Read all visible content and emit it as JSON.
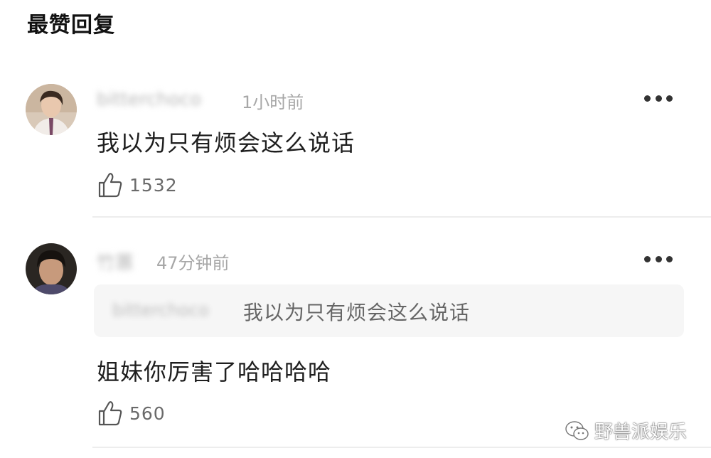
{
  "header": {
    "title": "最赞回复"
  },
  "comments": [
    {
      "username": "bitterchoco",
      "timestamp": "1小时前",
      "text": "我以为只有烦会这么说话",
      "likes": "1532"
    },
    {
      "username": "竹蕙",
      "timestamp": "47分钟前",
      "quote": {
        "username": "bitterchoco",
        "text": "我以为只有烦会这么说话"
      },
      "text": "姐妹你厉害了哈哈哈哈",
      "likes": "560"
    }
  ],
  "watermark": {
    "text": "野兽派娱乐",
    "icon": "wechat-icon"
  },
  "icons": {
    "more": "more-icon",
    "like": "thumbs-up-icon"
  }
}
